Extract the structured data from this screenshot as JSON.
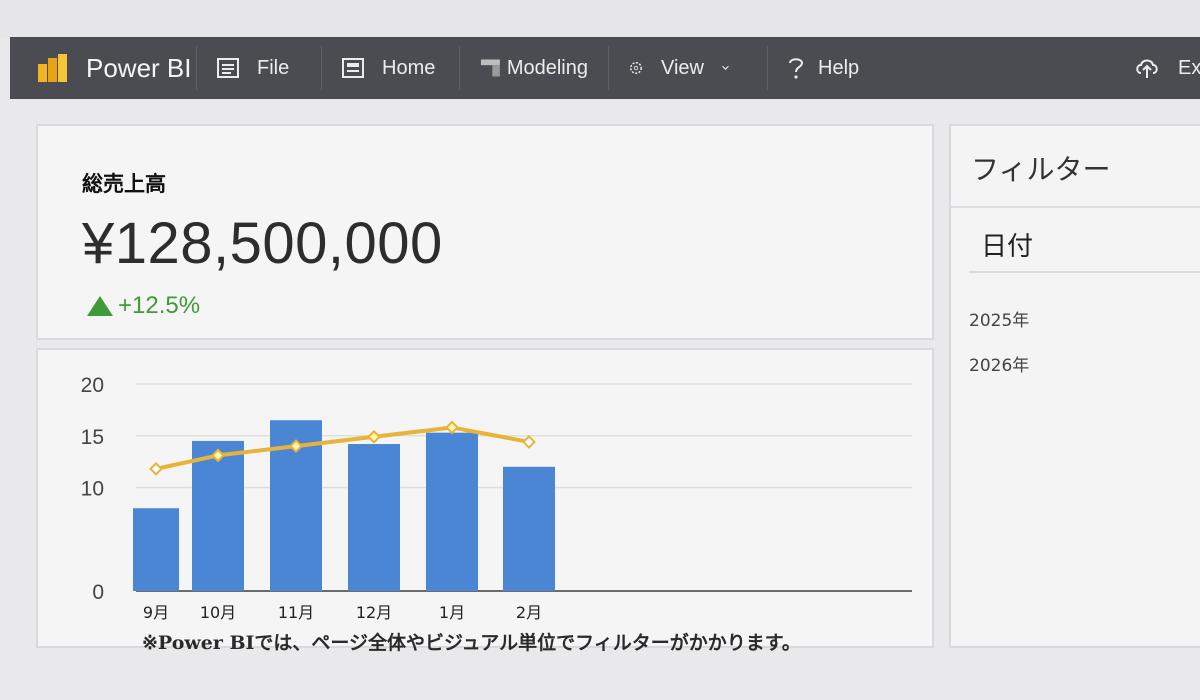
{
  "toolbar": {
    "app_title": "Power BI",
    "logo_icon": "powerbi-logo",
    "file_label": "File",
    "home_label": "Home",
    "modeling_label": "Modeling",
    "view_label": "View",
    "help_label": "Help",
    "export_label": "Ex",
    "colors": {
      "background": "#4a4c52",
      "logo": "#f2b51f"
    }
  },
  "kpi": {
    "label": "総売上高",
    "value": "¥128,500,000",
    "delta": "+12.5%",
    "delta_color": "#3f9a37"
  },
  "chart_data": {
    "type": "bar",
    "categories": [
      "9月",
      "10月",
      "11月",
      "12月",
      "1月",
      "2月"
    ],
    "series": [
      {
        "type": "bar",
        "values": [
          8,
          14.5,
          16.5,
          14.2,
          15.3,
          12
        ],
        "color": "#4a86d3"
      },
      {
        "type": "line",
        "values": [
          11.8,
          13.1,
          14,
          14.9,
          15.8,
          14.4
        ],
        "color": "#e8b33b"
      }
    ],
    "yticks": [
      "0",
      "10",
      "15",
      "20"
    ],
    "ylim": [
      0,
      20
    ],
    "grid": true
  },
  "caption": "※Power BIでは、ページ全体やビジュアル単位でフィルターがかかります。",
  "filter": {
    "title": "フィルター",
    "field": "日付",
    "options": [
      "2025年",
      "2026年"
    ]
  }
}
